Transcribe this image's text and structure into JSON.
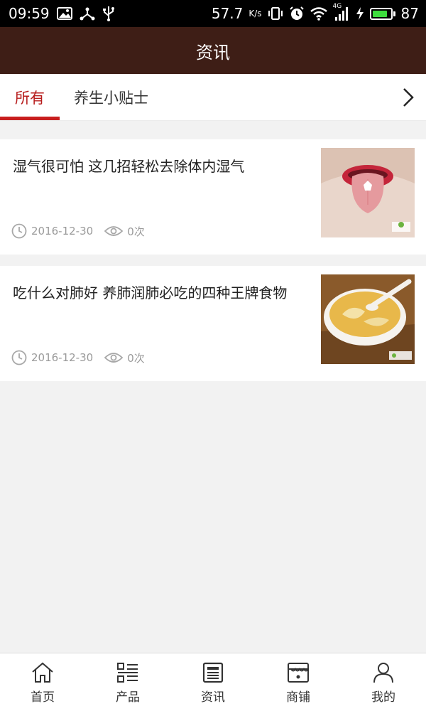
{
  "status_bar": {
    "time": "09:59",
    "speed": "57.7",
    "speed_unit": "K/s",
    "network": "4G",
    "battery": "87",
    "battery_level": 0.87
  },
  "header": {
    "title": "资讯"
  },
  "tabs": [
    {
      "label": "所有",
      "active": true
    },
    {
      "label": "养生小贴士",
      "active": false
    }
  ],
  "news": [
    {
      "title": "湿气很可怕 这几招轻松去除体内湿气",
      "date": "2016-12-30",
      "views": "0次",
      "thumb_icon": "tongue-photo"
    },
    {
      "title": "吃什么对肺好 养肺润肺必吃的四种王牌食物",
      "date": "2016-12-30",
      "views": "0次",
      "thumb_icon": "soup-bowl-photo"
    }
  ],
  "bottom_nav": [
    {
      "label": "首页",
      "icon": "home-icon"
    },
    {
      "label": "产品",
      "icon": "grid-list-icon"
    },
    {
      "label": "资讯",
      "icon": "news-icon"
    },
    {
      "label": "商铺",
      "icon": "store-icon"
    },
    {
      "label": "我的",
      "icon": "user-icon"
    }
  ],
  "colors": {
    "header_bg": "#3e1e16",
    "tab_active": "#c81e1e",
    "page_bg": "#f2f2f2"
  }
}
